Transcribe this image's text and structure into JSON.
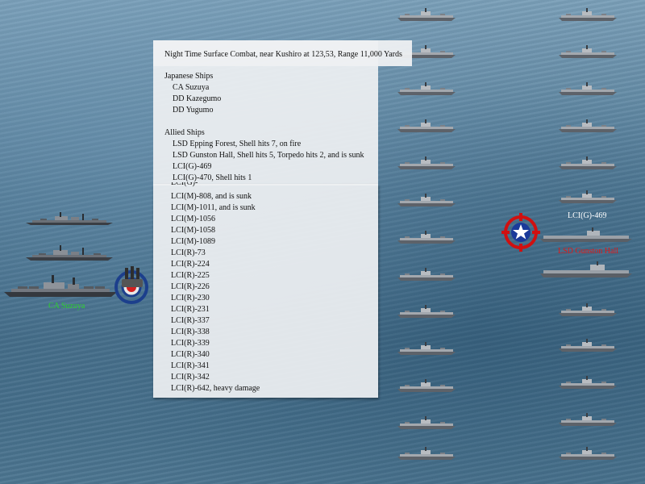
{
  "report": {
    "title": "Night Time Surface Combat, near Kushiro at 123,53, Range 11,000 Yards",
    "japanese_heading": "Japanese Ships",
    "japanese_ships": [
      "CA Suzuya",
      "DD Kazegumo",
      "DD Yugumo"
    ],
    "allied_heading": "Allied Ships",
    "allied_ships_upper": [
      "LSD Epping Forest, Shell hits 7,  on fire",
      "LSD Gunston Hall, Shell hits 5, Torpedo hits 2, and is sunk",
      "LCI(G)-469",
      "LCI(G)-470, Shell hits 1"
    ],
    "allied_ships_partial": "LCI(G)-",
    "allied_ships_lower": [
      "LCI(M)-808, and is sunk",
      "LCI(M)-1011, and is sunk",
      "LCI(M)-1056",
      "LCI(M)-1058",
      "LCI(M)-1089",
      "LCI(R)-73",
      "LCI(R)-224",
      "LCI(R)-225",
      "LCI(R)-226",
      "LCI(R)-230",
      "LCI(R)-231",
      "LCI(R)-337",
      "LCI(R)-338",
      "LCI(R)-339",
      "LCI(R)-340",
      "LCI(R)-341",
      "LCI(R)-342",
      "LCI(R)-642,  heavy damage"
    ]
  },
  "battle_labels": {
    "japanese_firing": "CA Suzuya",
    "allied_target_top": "LCI(G)-469",
    "allied_target_bottom": "LSD Gunston Hall"
  },
  "colors": {
    "japanese_label": "#2dd12d",
    "allied_top_label": "#ffffff",
    "allied_bottom_label": "#e01818",
    "target_ring": "#d01010",
    "allied_roundel": "#1a3a9a"
  },
  "icons": {
    "japanese_marker": "rising-sun-target-icon",
    "allied_marker": "allied-star-target-icon",
    "ship": "warship-silhouette-icon"
  }
}
